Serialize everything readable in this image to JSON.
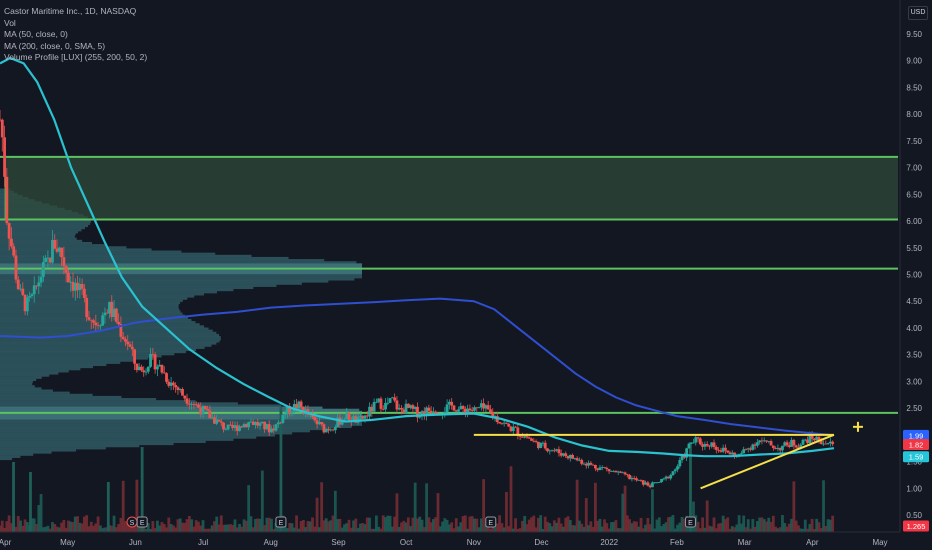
{
  "chart_data": {
    "type": "candlestick",
    "title": "Castor Maritime Inc., 1D, NASDAQ",
    "currency": "USD",
    "indicators": [
      "Vol",
      "MA (50, close, 0)",
      "MA (200, close, 0, SMA, 5)",
      "Volume Profile [LUX] (255, 200, 50, 2)"
    ],
    "x_ticks": [
      "Apr",
      "May",
      "Jun",
      "Jul",
      "Aug",
      "Sep",
      "Oct",
      "Nov",
      "Dec",
      "2022",
      "Feb",
      "Mar",
      "Apr",
      "May"
    ],
    "y_ticks": [
      0.5,
      1.0,
      1.5,
      2.0,
      2.5,
      3.0,
      3.5,
      4.0,
      4.5,
      5.0,
      5.5,
      6.0,
      6.5,
      7.0,
      7.5,
      8.0,
      8.5,
      9.0,
      9.5
    ],
    "y_tick_labels": [
      "0.50",
      "1.00",
      "1.50",
      "2.00",
      "2.50",
      "3.00",
      "3.50",
      "4.00",
      "4.50",
      "5.00",
      "5.50",
      "6.00",
      "6.50",
      "7.00",
      "7.50",
      "8.00",
      "8.50",
      "9.00",
      "9.50"
    ],
    "ylim": [
      0.2,
      9.9
    ],
    "price_levels": [
      {
        "label": "7.20",
        "value": 7.2
      },
      {
        "label": "6.03",
        "value": 6.03
      },
      {
        "label": "5.11",
        "value": 5.11
      },
      {
        "label": "2.41",
        "value": 2.41
      }
    ],
    "zone": {
      "from": 6.03,
      "to": 7.2
    },
    "resistance_line": {
      "value": 2.0,
      "from_month": 7.0,
      "to_month": 12.32
    },
    "rising_trendline": {
      "from": {
        "month": 10.35,
        "value": 1.0
      },
      "to": {
        "month": 12.32,
        "value": 2.0
      }
    },
    "axis_badges": [
      {
        "label": "1.99",
        "value": 1.99,
        "color": "#2962ff"
      },
      {
        "label": "1.82",
        "value": 1.82,
        "color": "#f23645"
      },
      {
        "label": "1.59",
        "value": 1.59,
        "color": "#26c6da"
      },
      {
        "label": "1.265",
        "value": 0.32,
        "color": "#f23645"
      }
    ],
    "event_markers": [
      {
        "label": "S",
        "month": 1.95
      },
      {
        "label": "E",
        "month": 2.1
      },
      {
        "label": "E",
        "month": 4.15
      },
      {
        "label": "E",
        "month": 7.25
      },
      {
        "label": "E",
        "month": 10.2
      }
    ],
    "ma50": [
      [
        0,
        8.95
      ],
      [
        0.15,
        9.05
      ],
      [
        0.35,
        8.95
      ],
      [
        0.55,
        8.6
      ],
      [
        0.8,
        7.9
      ],
      [
        1.05,
        7.0
      ],
      [
        1.3,
        6.3
      ],
      [
        1.55,
        5.6
      ],
      [
        1.8,
        4.95
      ],
      [
        2.1,
        4.4
      ],
      [
        2.45,
        4.0
      ],
      [
        2.8,
        3.6
      ],
      [
        3.2,
        3.25
      ],
      [
        3.6,
        2.95
      ],
      [
        3.95,
        2.72
      ],
      [
        4.3,
        2.5
      ],
      [
        4.7,
        2.35
      ],
      [
        5.1,
        2.25
      ],
      [
        5.5,
        2.28
      ],
      [
        6.0,
        2.35
      ],
      [
        6.5,
        2.38
      ],
      [
        7.0,
        2.4
      ],
      [
        7.4,
        2.3
      ],
      [
        7.8,
        2.15
      ],
      [
        8.2,
        1.95
      ],
      [
        8.6,
        1.8
      ],
      [
        9.0,
        1.7
      ],
      [
        9.4,
        1.68
      ],
      [
        9.8,
        1.65
      ],
      [
        10.1,
        1.62
      ],
      [
        10.4,
        1.6
      ],
      [
        10.8,
        1.6
      ],
      [
        11.2,
        1.63
      ],
      [
        11.6,
        1.65
      ],
      [
        12.0,
        1.7
      ],
      [
        12.32,
        1.75
      ]
    ],
    "ma200": [
      [
        0,
        3.85
      ],
      [
        0.6,
        3.82
      ],
      [
        1.0,
        3.85
      ],
      [
        1.5,
        3.95
      ],
      [
        2.0,
        4.1
      ],
      [
        2.5,
        4.18
      ],
      [
        3.0,
        4.25
      ],
      [
        3.5,
        4.3
      ],
      [
        4.0,
        4.38
      ],
      [
        4.5,
        4.42
      ],
      [
        5.0,
        4.45
      ],
      [
        5.5,
        4.48
      ],
      [
        6.0,
        4.52
      ],
      [
        6.5,
        4.55
      ],
      [
        7.0,
        4.5
      ],
      [
        7.3,
        4.35
      ],
      [
        7.6,
        4.05
      ],
      [
        7.9,
        3.75
      ],
      [
        8.2,
        3.45
      ],
      [
        8.5,
        3.15
      ],
      [
        8.8,
        2.9
      ],
      [
        9.1,
        2.7
      ],
      [
        9.4,
        2.55
      ],
      [
        9.7,
        2.45
      ],
      [
        10.0,
        2.35
      ],
      [
        10.4,
        2.28
      ],
      [
        10.8,
        2.2
      ],
      [
        11.2,
        2.14
      ],
      [
        11.6,
        2.08
      ],
      [
        12.0,
        2.03
      ],
      [
        12.32,
        1.99
      ]
    ],
    "price_path": [
      [
        0,
        7.9
      ],
      [
        0.05,
        7.4
      ],
      [
        0.1,
        6.1
      ],
      [
        0.15,
        5.7
      ],
      [
        0.2,
        5.3
      ],
      [
        0.25,
        4.9
      ],
      [
        0.3,
        4.6
      ],
      [
        0.4,
        4.4
      ],
      [
        0.5,
        4.6
      ],
      [
        0.6,
        5.0
      ],
      [
        0.7,
        5.2
      ],
      [
        0.8,
        5.6
      ],
      [
        0.9,
        5.4
      ],
      [
        1.0,
        5.0
      ],
      [
        1.1,
        4.8
      ],
      [
        1.2,
        4.6
      ],
      [
        1.3,
        4.3
      ],
      [
        1.4,
        4.1
      ],
      [
        1.5,
        4.2
      ],
      [
        1.6,
        4.4
      ],
      [
        1.7,
        4.2
      ],
      [
        1.8,
        3.9
      ],
      [
        1.9,
        3.7
      ],
      [
        2.0,
        3.3
      ],
      [
        2.1,
        3.2
      ],
      [
        2.2,
        3.4
      ],
      [
        2.3,
        3.35
      ],
      [
        2.4,
        3.2
      ],
      [
        2.5,
        3.0
      ],
      [
        2.6,
        2.9
      ],
      [
        2.7,
        2.75
      ],
      [
        2.8,
        2.65
      ],
      [
        2.9,
        2.55
      ],
      [
        3.0,
        2.45
      ],
      [
        3.1,
        2.35
      ],
      [
        3.2,
        2.25
      ],
      [
        3.3,
        2.15
      ],
      [
        3.4,
        2.1
      ],
      [
        3.5,
        2.15
      ],
      [
        3.6,
        2.2
      ],
      [
        3.7,
        2.25
      ],
      [
        3.8,
        2.2
      ],
      [
        3.9,
        2.15
      ],
      [
        4.0,
        2.1
      ],
      [
        4.1,
        2.2
      ],
      [
        4.2,
        2.4
      ],
      [
        4.3,
        2.5
      ],
      [
        4.4,
        2.55
      ],
      [
        4.5,
        2.45
      ],
      [
        4.6,
        2.3
      ],
      [
        4.7,
        2.2
      ],
      [
        4.8,
        2.1
      ],
      [
        4.9,
        2.15
      ],
      [
        5.0,
        2.25
      ],
      [
        5.1,
        2.35
      ],
      [
        5.2,
        2.3
      ],
      [
        5.3,
        2.25
      ],
      [
        5.4,
        2.35
      ],
      [
        5.5,
        2.5
      ],
      [
        5.6,
        2.6
      ],
      [
        5.7,
        2.55
      ],
      [
        5.8,
        2.65
      ],
      [
        5.9,
        2.45
      ],
      [
        6.0,
        2.5
      ],
      [
        6.1,
        2.45
      ],
      [
        6.2,
        2.4
      ],
      [
        6.3,
        2.45
      ],
      [
        6.4,
        2.5
      ],
      [
        6.5,
        2.45
      ],
      [
        6.6,
        2.5
      ],
      [
        6.7,
        2.55
      ],
      [
        6.8,
        2.45
      ],
      [
        6.9,
        2.5
      ],
      [
        7.0,
        2.45
      ],
      [
        7.1,
        2.5
      ],
      [
        7.2,
        2.45
      ],
      [
        7.3,
        2.35
      ],
      [
        7.4,
        2.25
      ],
      [
        7.5,
        2.15
      ],
      [
        7.6,
        2.1
      ],
      [
        7.7,
        2.0
      ],
      [
        7.8,
        1.95
      ],
      [
        7.9,
        1.85
      ],
      [
        8.0,
        1.8
      ],
      [
        8.1,
        1.75
      ],
      [
        8.2,
        1.7
      ],
      [
        8.3,
        1.65
      ],
      [
        8.4,
        1.6
      ],
      [
        8.5,
        1.55
      ],
      [
        8.6,
        1.5
      ],
      [
        8.7,
        1.45
      ],
      [
        8.8,
        1.4
      ],
      [
        8.9,
        1.38
      ],
      [
        9.0,
        1.33
      ],
      [
        9.1,
        1.3
      ],
      [
        9.2,
        1.25
      ],
      [
        9.3,
        1.2
      ],
      [
        9.4,
        1.15
      ],
      [
        9.5,
        1.1
      ],
      [
        9.6,
        1.05
      ],
      [
        9.7,
        1.1
      ],
      [
        9.8,
        1.15
      ],
      [
        9.9,
        1.25
      ],
      [
        10.0,
        1.4
      ],
      [
        10.1,
        1.6
      ],
      [
        10.2,
        1.85
      ],
      [
        10.3,
        1.9
      ],
      [
        10.4,
        1.8
      ],
      [
        10.5,
        1.85
      ],
      [
        10.6,
        1.75
      ],
      [
        10.7,
        1.7
      ],
      [
        10.8,
        1.65
      ],
      [
        10.9,
        1.6
      ],
      [
        11.0,
        1.7
      ],
      [
        11.1,
        1.8
      ],
      [
        11.2,
        1.9
      ],
      [
        11.3,
        1.85
      ],
      [
        11.4,
        1.8
      ],
      [
        11.5,
        1.75
      ],
      [
        11.6,
        1.8
      ],
      [
        11.7,
        1.85
      ],
      [
        11.8,
        1.8
      ],
      [
        11.9,
        1.9
      ],
      [
        12.0,
        1.95
      ],
      [
        12.1,
        1.9
      ],
      [
        12.2,
        1.85
      ],
      [
        12.3,
        1.82
      ]
    ]
  }
}
